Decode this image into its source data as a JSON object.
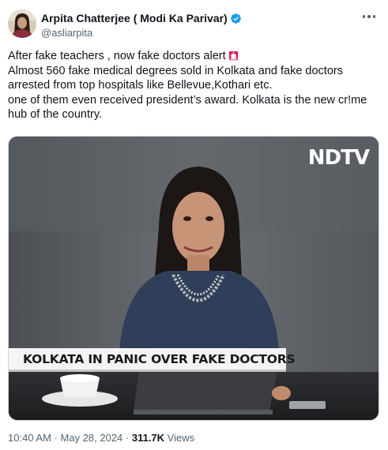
{
  "author": {
    "display_name": "Arpita Chatterjee ( Modi Ka Parivar)",
    "handle": "@asliarpita",
    "verified": true
  },
  "icons": {
    "verified": "verified-badge-icon",
    "more": "more-options-icon",
    "siren": "police-siren-emoji",
    "accent_color": "#1d9bf0"
  },
  "tweet": {
    "lines": [
      "After fake teachers , now fake doctors alert",
      "Almost 560 fake medical degrees sold in Kolkata and fake doctors arrested from top hospitals like Bellevue,Kothari etc.",
      "one of them even received president’s award. Kolkata is the new cr!me hub of the country."
    ]
  },
  "media": {
    "channel_logo": "NDTV",
    "ticker": "KOLKATA IN PANIC OVER FAKE DOCTORS"
  },
  "meta": {
    "time": "10:40 AM",
    "separator_1": " · ",
    "date": "May 28, 2024",
    "separator_2": " · ",
    "views_count": "311.7K",
    "views_label": " Views"
  }
}
